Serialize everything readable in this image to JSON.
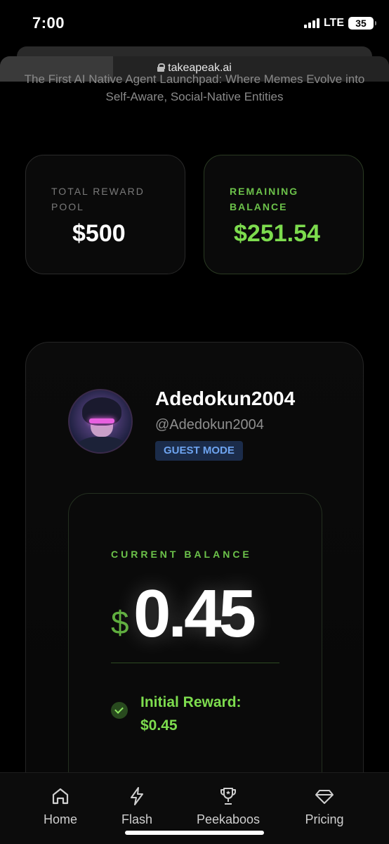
{
  "status_bar": {
    "time": "7:00",
    "network": "LTE",
    "battery": "35"
  },
  "browser": {
    "url": "takeapeak.ai",
    "load_progress_percent": 29
  },
  "tagline": "The First AI Native Agent Launchpad: Where Memes Evolve into Self-Aware, Social-Native Entities",
  "stats": {
    "total_reward_pool": {
      "label": "TOTAL REWARD POOL",
      "value": "$500"
    },
    "remaining_balance": {
      "label": "REMAINING BALANCE",
      "value": "$251.54"
    }
  },
  "profile": {
    "display_name": "Adedokun2004",
    "handle": "@Adedokun2004",
    "badge": "GUEST MODE"
  },
  "balance": {
    "label": "CURRENT BALANCE",
    "currency_symbol": "$",
    "value": "0.45",
    "reward_label": "Initial Reward:",
    "reward_value": "$0.45"
  },
  "nav": [
    {
      "label": "Home",
      "icon": "home-icon"
    },
    {
      "label": "Flash",
      "icon": "lightning-icon"
    },
    {
      "label": "Peekaboos",
      "icon": "trophy-icon"
    },
    {
      "label": "Pricing",
      "icon": "diamond-icon"
    }
  ],
  "colors": {
    "accent_green": "#7ddc4e",
    "badge_blue": "#6ea4f0",
    "background": "#000000"
  }
}
